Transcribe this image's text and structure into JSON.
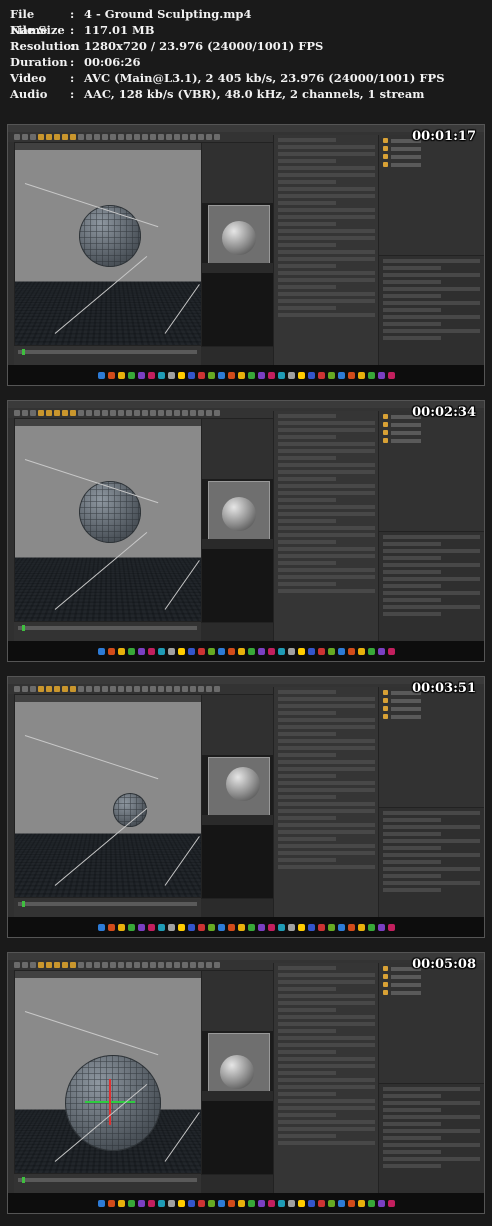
{
  "info": [
    {
      "key": "File Name",
      "value": "4 - Ground Sculpting.mp4"
    },
    {
      "key": "File Size",
      "value": "117.01 MB"
    },
    {
      "key": "Resolution",
      "value": "1280x720 / 23.976 (24000/1001) FPS"
    },
    {
      "key": "Duration",
      "value": "00:06:26"
    },
    {
      "key": "Video",
      "value": "AVC (Main@L3.1), 2 405 kb/s, 23.976 (24000/1001) FPS"
    },
    {
      "key": "Audio",
      "value": "AAC, 128 kb/s (VBR), 48.0 kHz, 2 channels, 1 stream"
    }
  ],
  "colon": ":",
  "frames": [
    {
      "timestamp": "00:01:17"
    },
    {
      "timestamp": "00:02:34"
    },
    {
      "timestamp": "00:03:51"
    },
    {
      "timestamp": "00:05:08"
    }
  ]
}
